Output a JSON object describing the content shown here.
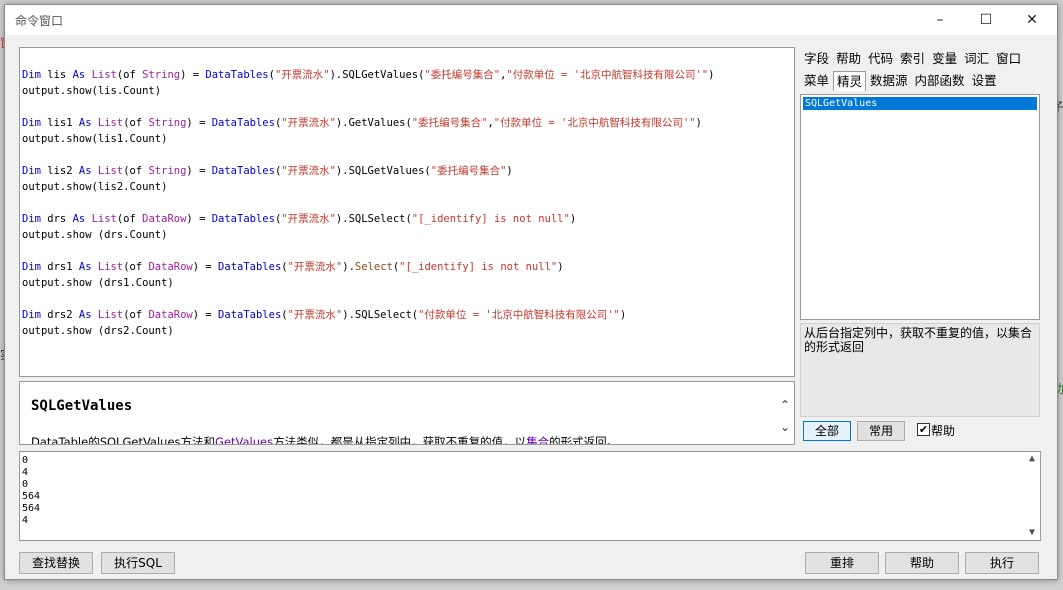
{
  "window": {
    "title": "命令窗口",
    "controls": {
      "minimize": "–",
      "maximize": "☐",
      "close": "✕"
    }
  },
  "editor": {
    "lines": [
      [
        "Dim lis As List(of String) = DataTables(\"开票流水\").SQLGetValues(\"委托编号集合\",\"付款单位 = '北京中航智科技有限公司'\")"
      ],
      [
        "output.show(lis.Count)"
      ],
      [
        "Dim lis1 As List(of String) = DataTables(\"开票流水\").GetValues(\"委托编号集合\",\"付款单位 = '北京中航智科技有限公司'\")"
      ],
      [
        "output.show(lis1.Count)"
      ],
      [
        "Dim lis2 As List(of String) = DataTables(\"开票流水\").SQLGetValues(\"委托编号集合\")"
      ],
      [
        "output.show(lis2.Count)"
      ],
      [
        "Dim drs As List(of DataRow) = DataTables(\"开票流水\").SQLSelect(\"[_identify] is not null\")"
      ],
      [
        "output.show (drs.Count)"
      ],
      [
        "Dim drs1 As List(of DataRow) = DataTables(\"开票流水\").Select(\"[_identify] is not null\")"
      ],
      [
        "output.show (drs1.Count)"
      ],
      [
        "Dim drs2 As List(of DataRow) = DataTables(\"开票流水\").SQLSelect(\"付款单位 = '北京中航智科技有限公司'\")"
      ],
      [
        "output.show (drs2.Count)"
      ]
    ]
  },
  "help_panel": {
    "title": "SQLGetValues",
    "text_parts": [
      "DataTable的SQLGetValues方法和",
      "GetValues",
      "方法类似，都是从指定列中，获取不重复的值，以",
      "集合",
      "的形式返回。"
    ],
    "scroll_up": "⌃",
    "scroll_down": "⌄"
  },
  "side_tabs": {
    "row1": [
      "字段",
      "帮助",
      "代码",
      "索引",
      "变量",
      "词汇",
      "窗口"
    ],
    "row2": [
      "菜单",
      "精灵",
      "数据源",
      "内部函数",
      "设置"
    ],
    "active": "精灵"
  },
  "side_list": {
    "selected_item": "SQLGetValues"
  },
  "side_description": "从后台指定列中，获取不重复的值，以集合的形式返回",
  "filter_buttons": {
    "all": "全部",
    "common": "常用",
    "help_check": "帮助",
    "help_checked": "✔"
  },
  "output_lines": [
    "0",
    "4",
    "0",
    "564",
    "564",
    "4"
  ],
  "bottom_buttons": {
    "find_replace": "查找替换",
    "exec_sql": "执行SQL",
    "rearrange": "重排",
    "help": "帮助",
    "execute": "执行"
  },
  "background_fragments": {
    "left_a": "窗",
    "left_b": "实",
    "right_a": "子",
    "right_b": "助"
  }
}
